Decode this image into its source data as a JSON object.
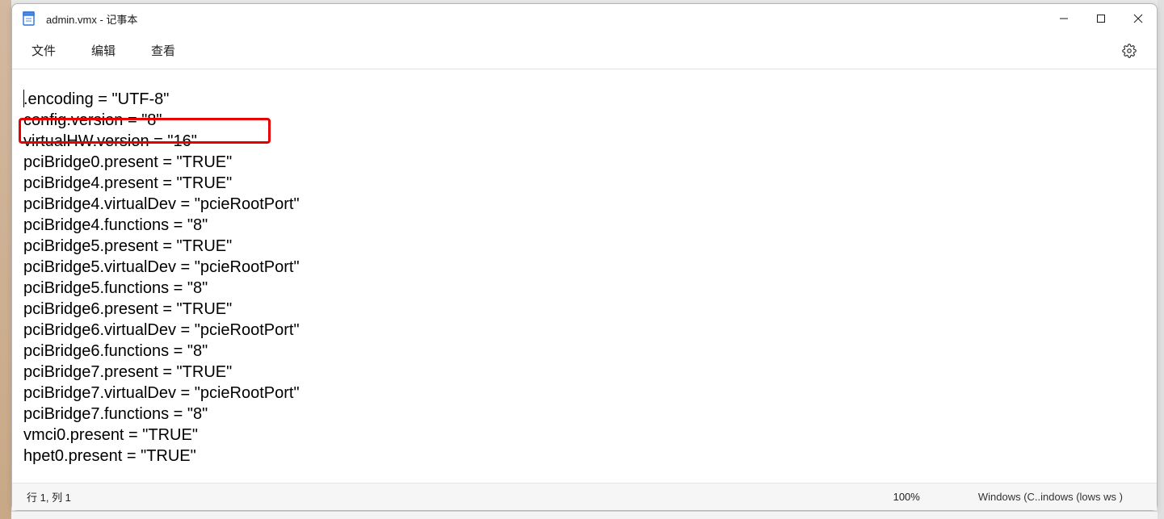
{
  "window": {
    "title": "admin.vmx - 记事本"
  },
  "menu": {
    "file": "文件",
    "edit": "编辑",
    "view": "查看"
  },
  "content_lines": {
    "l0": ".encoding = \"UTF-8\"",
    "l1": "config.version = \"8\"",
    "l2": "virtualHW.version = \"16\"",
    "l3": "pciBridge0.present = \"TRUE\"",
    "l4": "pciBridge4.present = \"TRUE\"",
    "l5": "pciBridge4.virtualDev = \"pcieRootPort\"",
    "l6": "pciBridge4.functions = \"8\"",
    "l7": "pciBridge5.present = \"TRUE\"",
    "l8": "pciBridge5.virtualDev = \"pcieRootPort\"",
    "l9": "pciBridge5.functions = \"8\"",
    "l10": "pciBridge6.present = \"TRUE\"",
    "l11": "pciBridge6.virtualDev = \"pcieRootPort\"",
    "l12": "pciBridge6.functions = \"8\"",
    "l13": "pciBridge7.present = \"TRUE\"",
    "l14": "pciBridge7.virtualDev = \"pcieRootPort\"",
    "l15": "pciBridge7.functions = \"8\"",
    "l16": "vmci0.present = \"TRUE\"",
    "l17": "hpet0.present = \"TRUE\""
  },
  "statusbar": {
    "position": "行 1, 列 1",
    "zoom": "100%",
    "encoding": "Windows (C..indows (lows ws )"
  }
}
